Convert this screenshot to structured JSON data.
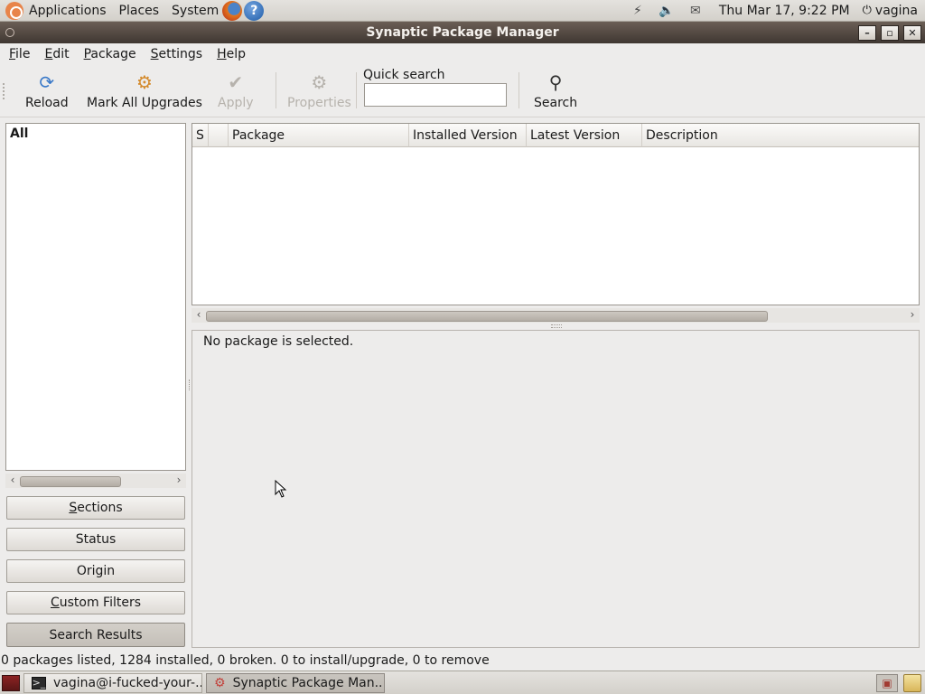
{
  "top_panel": {
    "menus": [
      "Applications",
      "Places",
      "System"
    ],
    "clock": "Thu Mar 17,  9:22 PM",
    "user": "vagina",
    "icons": [
      "ubuntu-logo-icon",
      "firefox-icon",
      "help-icon",
      "network-icon",
      "volume-icon",
      "mail-icon",
      "power-icon"
    ]
  },
  "window": {
    "title": "Synaptic Package Manager",
    "buttons": [
      "minimize",
      "maximize",
      "close"
    ]
  },
  "menubar": {
    "items": [
      {
        "u": "F",
        "rest": "ile"
      },
      {
        "u": "E",
        "rest": "dit"
      },
      {
        "u": "P",
        "rest": "ackage"
      },
      {
        "u": "S",
        "rest": "ettings"
      },
      {
        "u": "H",
        "rest": "elp"
      }
    ]
  },
  "toolbar": {
    "reload": "Reload",
    "mark_all": "Mark All Upgrades",
    "apply": "Apply",
    "properties": "Properties",
    "quick_search_label": "Quick search",
    "quick_search_value": "",
    "search": "Search"
  },
  "left_pane": {
    "list": [
      "All"
    ],
    "buttons": {
      "sections_u": "S",
      "sections_rest": "ections",
      "status": "Status",
      "origin": "Origin",
      "custom_u": "C",
      "custom_rest": "ustom Filters",
      "search_results": "Search Results"
    }
  },
  "table": {
    "columns": [
      "S",
      "",
      "Package",
      "Installed Version",
      "Latest Version",
      "Description"
    ],
    "rows": []
  },
  "detail": {
    "message": "No package is selected."
  },
  "statusbar": {
    "text": "0 packages listed, 1284 installed, 0 broken. 0 to install/upgrade, 0 to remove"
  },
  "taskbar": {
    "tasks": [
      "vagina@i-fucked-your-...",
      "Synaptic Package Man..."
    ]
  }
}
